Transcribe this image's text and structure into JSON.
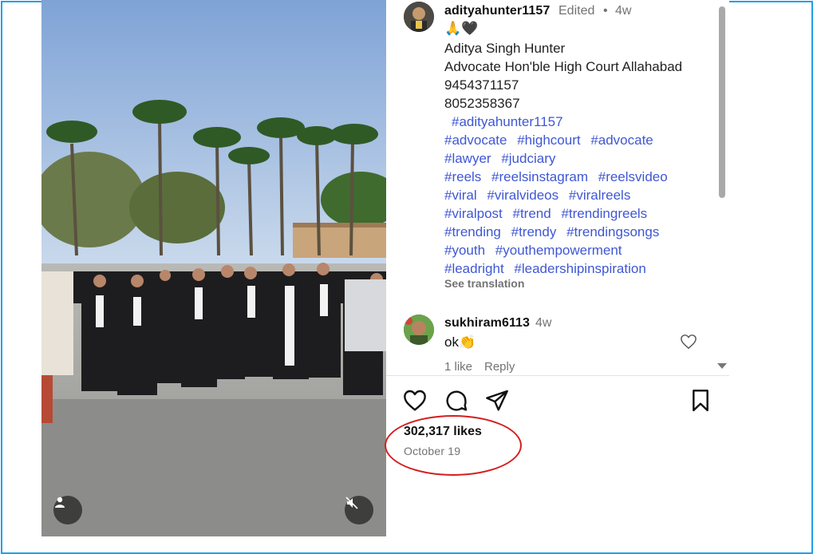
{
  "post": {
    "username": "adityahunter1157",
    "edited_label": "Edited",
    "dot": "•",
    "time": "4w",
    "emoji_line": "🙏🖤",
    "caption_lines": [
      "Aditya Singh Hunter",
      "Advocate Hon'ble High Court Allahabad",
      "9454371157",
      "8052358367"
    ],
    "hashtag_rows": [
      [
        "#adityahunter1157"
      ],
      [
        "#advocate",
        "#highcourt",
        "#advocate"
      ],
      [
        "#lawyer",
        "#judciary"
      ],
      [
        "#reels",
        "#reelsinstagram",
        "#reelsvideo"
      ],
      [
        "#viral",
        "#viralvideos",
        "#viralreels"
      ],
      [
        "#viralpost",
        "#trend",
        "#trendingreels"
      ],
      [
        "#trending",
        "#trendy",
        "#trendingsongs"
      ],
      [
        "#youth",
        "#youthempowerment"
      ],
      [
        "#leadright",
        "#leadershipinspiration"
      ]
    ],
    "see_translation": "See translation",
    "likes": "302,317 likes",
    "date": "October 19"
  },
  "comment": {
    "username": "sukhiram6113",
    "time": "4w",
    "text": "ok👏",
    "likes": "1 like",
    "reply": "Reply"
  },
  "icons": {
    "like": "heart-icon",
    "comment": "comment-icon",
    "share": "send-icon",
    "save": "bookmark-icon",
    "tag": "user-icon",
    "mute": "muted-speaker-icon"
  },
  "colors": {
    "hashtag": "#3f57d4",
    "highlight_circle": "#d41e1e",
    "frame": "#1f9fe8"
  }
}
